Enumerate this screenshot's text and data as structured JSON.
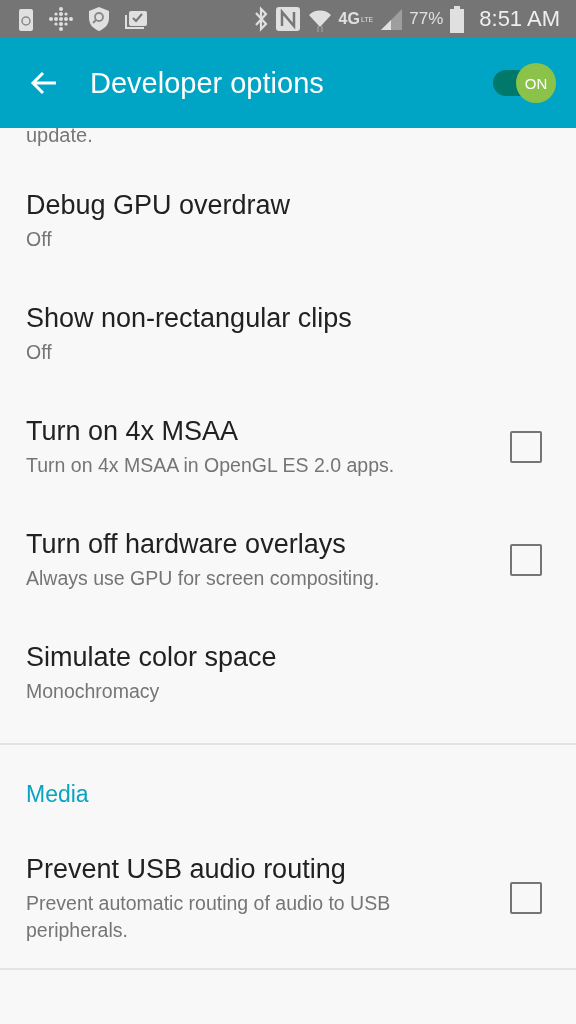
{
  "status_bar": {
    "network": "4G",
    "network_sub": "LTE",
    "battery": "77%",
    "time": "8:51 AM"
  },
  "app_bar": {
    "title": "Developer options",
    "master_switch": {
      "label": "ON",
      "on": true
    }
  },
  "partial_text": "update.",
  "sections": [
    {
      "items": [
        {
          "kind": "value",
          "title": "Debug GPU overdraw",
          "summary": "Off"
        },
        {
          "kind": "value",
          "title": "Show non-rectangular clips",
          "summary": "Off"
        },
        {
          "kind": "checkbox",
          "title": "Turn on 4x MSAA",
          "summary": "Turn on 4x MSAA in OpenGL ES 2.0 apps.",
          "checked": false
        },
        {
          "kind": "checkbox",
          "title": "Turn off hardware overlays",
          "summary": "Always use GPU for screen compositing.",
          "checked": false
        },
        {
          "kind": "value",
          "title": "Simulate color space",
          "summary": "Monochromacy"
        }
      ]
    },
    {
      "header": "Media",
      "items": [
        {
          "kind": "checkbox",
          "title": "Prevent USB audio routing",
          "summary": "Prevent automatic routing of audio to USB peripherals.",
          "checked": false
        }
      ]
    }
  ]
}
